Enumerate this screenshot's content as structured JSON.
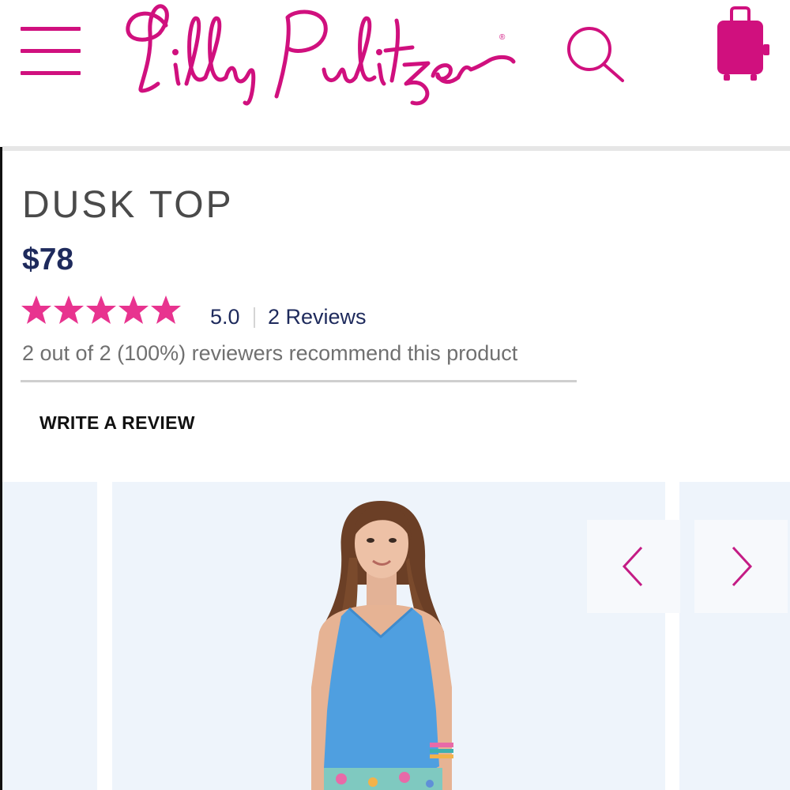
{
  "header": {
    "menu_icon": "hamburger-menu-icon",
    "brand": "Lilly Pulitzer",
    "brand_mark": "®",
    "search_icon": "search-icon",
    "cart_icon": "shopping-bag-icon",
    "accent_color": "#d0107e"
  },
  "product": {
    "title": "DUSK TOP",
    "price": "$78",
    "rating": {
      "stars": 5,
      "max_stars": 5,
      "value": "5.0",
      "reviews_label": "2 Reviews",
      "recommend_text": "2 out of 2 (100%) reviewers recommend this product",
      "star_color": "#e8338f"
    },
    "write_review_label": "WRITE A REVIEW",
    "price_color": "#1e2a5c"
  },
  "gallery": {
    "prev_icon": "chevron-left-icon",
    "next_icon": "chevron-right-icon",
    "image_desc_icon": "product-photo",
    "top_color": "#4f9fe0"
  }
}
